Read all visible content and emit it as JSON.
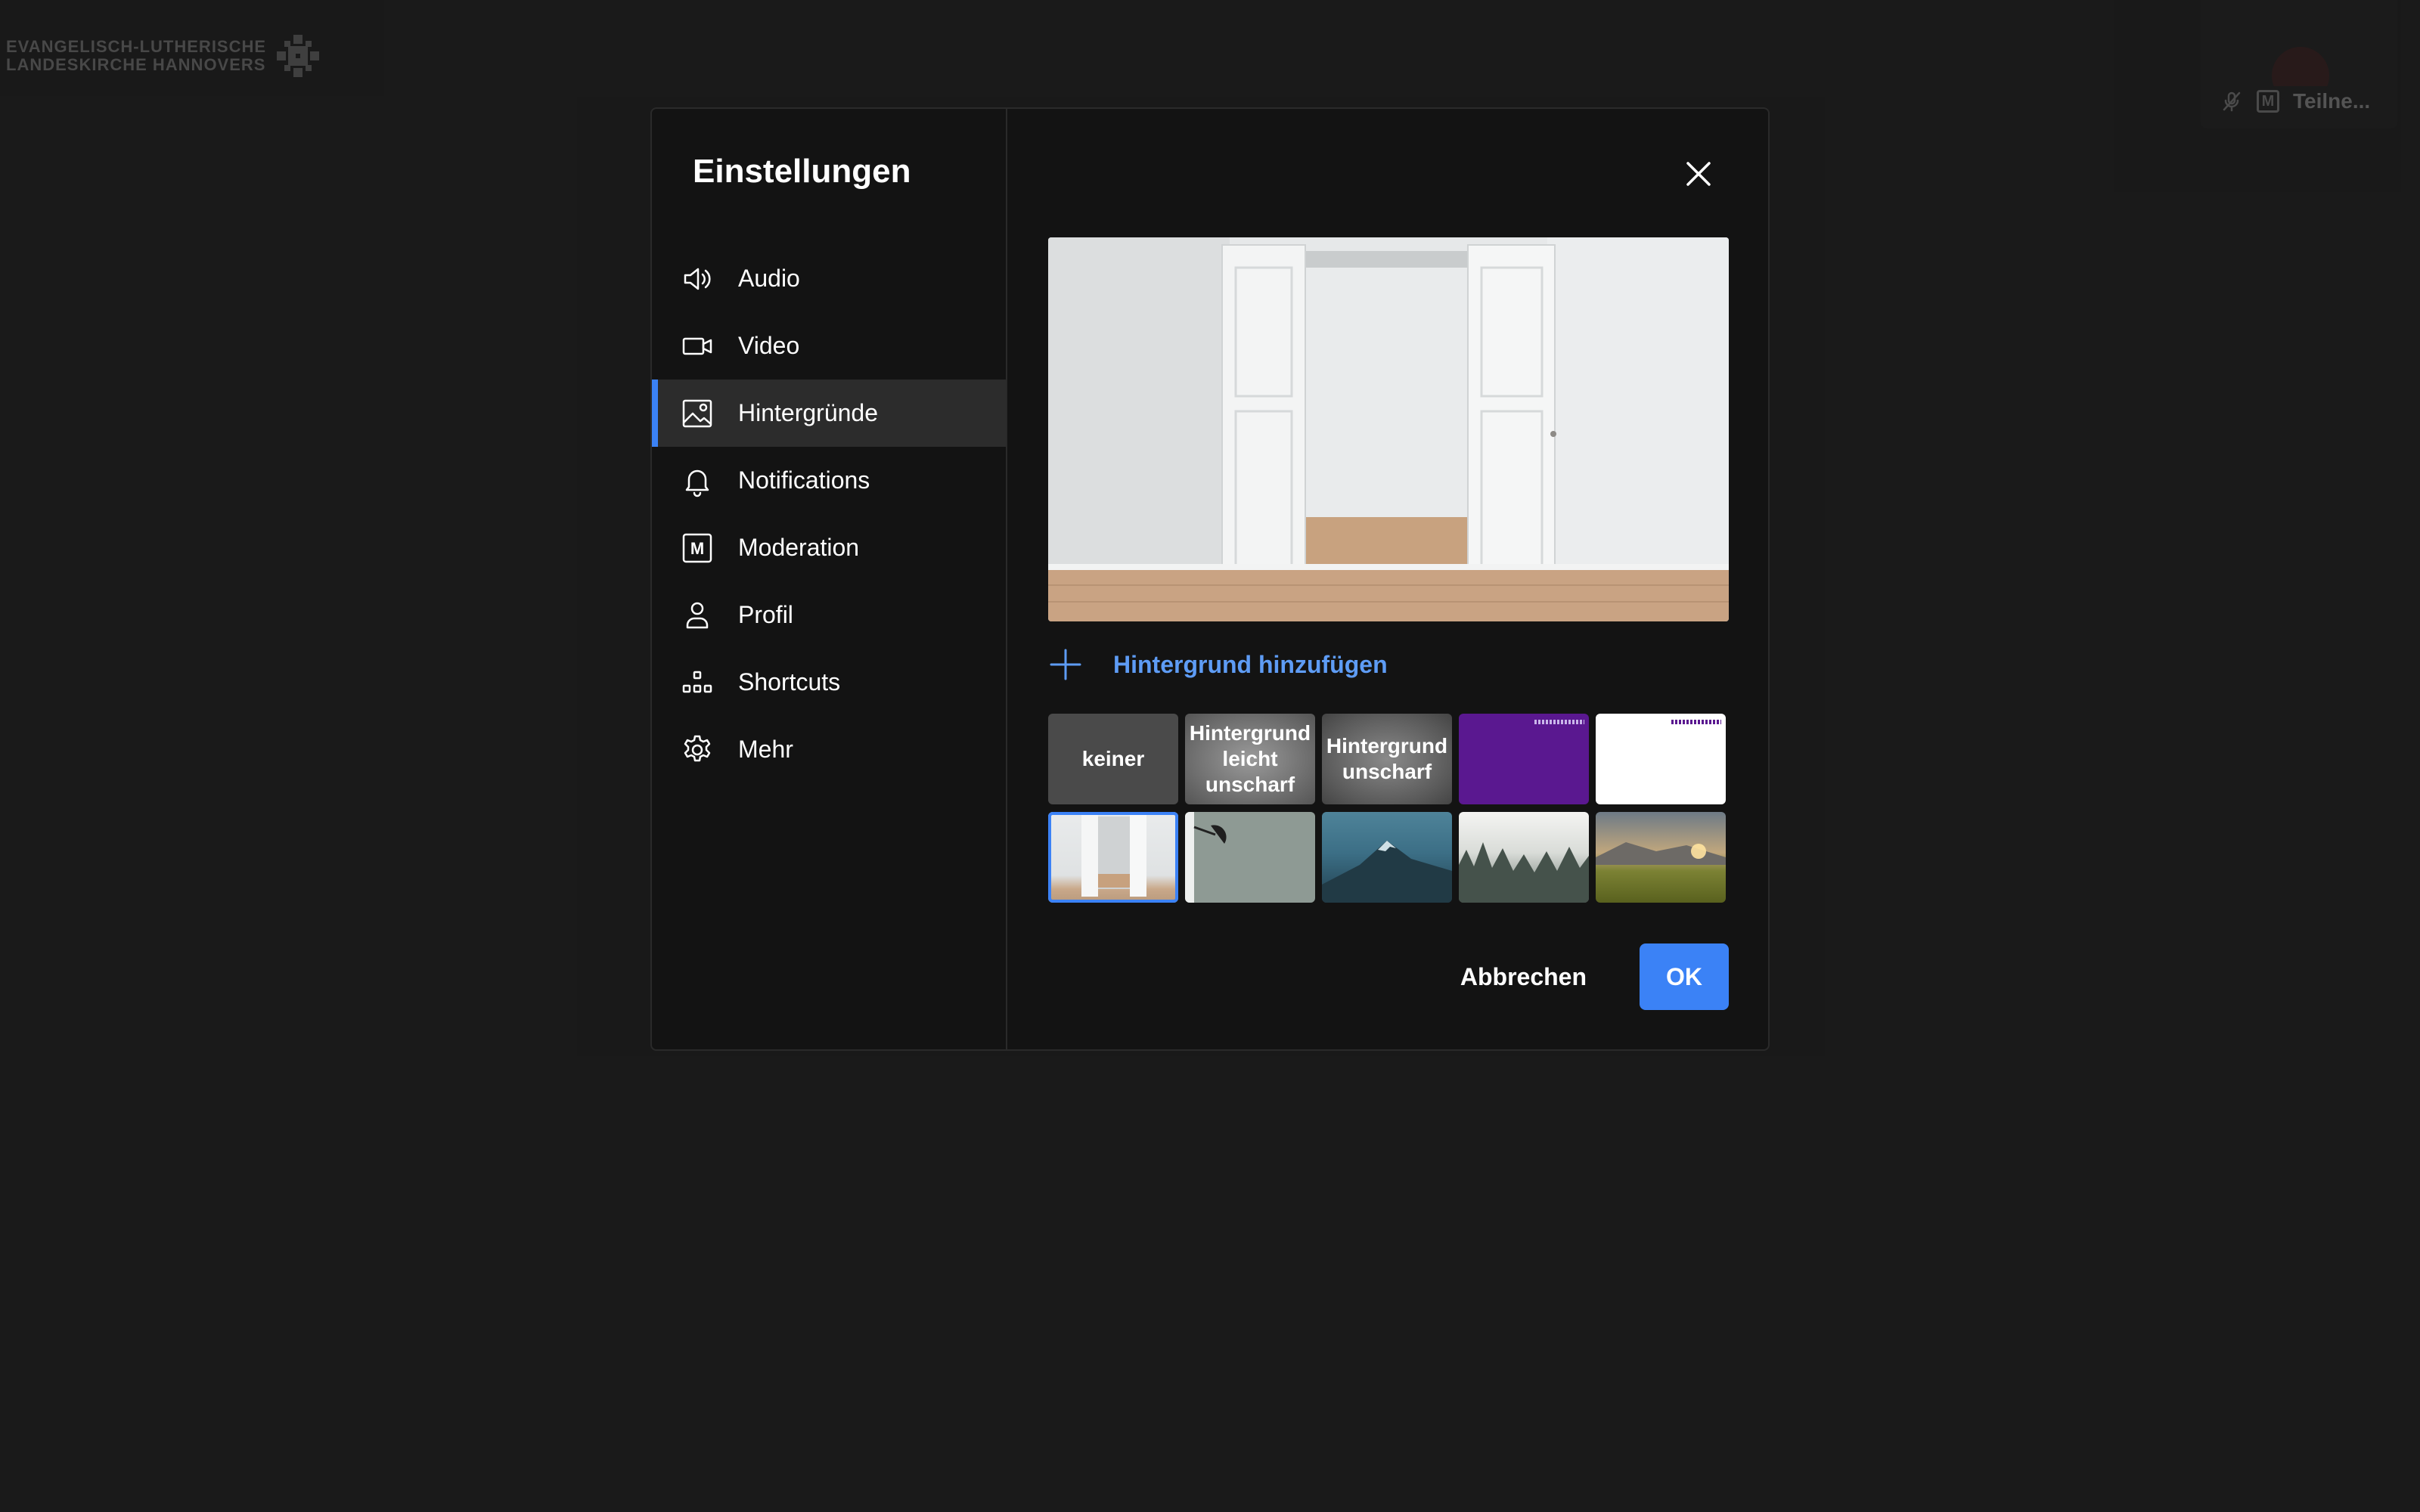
{
  "background": {
    "logo_line1": "EVANGELISCH-LUTHERISCHE",
    "logo_line2": "LANDESKIRCHE HANNOVERS",
    "participant": {
      "name": "Teilne...",
      "moderator_badge": "M"
    }
  },
  "dialog": {
    "title": "Einstellungen",
    "nav": [
      {
        "label": "Audio",
        "icon": "speaker-icon"
      },
      {
        "label": "Video",
        "icon": "camera-icon"
      },
      {
        "label": "Hintergründe",
        "icon": "image-icon",
        "active": true
      },
      {
        "label": "Notifications",
        "icon": "bell-icon"
      },
      {
        "label": "Moderation",
        "icon": "moderator-icon",
        "badge": "M"
      },
      {
        "label": "Profil",
        "icon": "person-icon"
      },
      {
        "label": "Shortcuts",
        "icon": "shortcuts-icon"
      },
      {
        "label": "Mehr",
        "icon": "gear-icon"
      }
    ],
    "add_background_label": "Hintergrund hinzufügen",
    "tiles": [
      {
        "label": "keiner"
      },
      {
        "label": "Hintergrund leicht unscharf"
      },
      {
        "label": "Hintergrund unscharf"
      },
      {
        "label": ""
      },
      {
        "label": ""
      },
      {
        "label": "",
        "selected": true
      },
      {
        "label": ""
      },
      {
        "label": ""
      },
      {
        "label": ""
      },
      {
        "label": ""
      }
    ],
    "cancel_label": "Abbrechen",
    "ok_label": "OK"
  },
  "colors": {
    "accent": "#3b82f6",
    "link": "#5e9cf5",
    "dialog_bg": "#131313",
    "page_bg": "#222222"
  }
}
